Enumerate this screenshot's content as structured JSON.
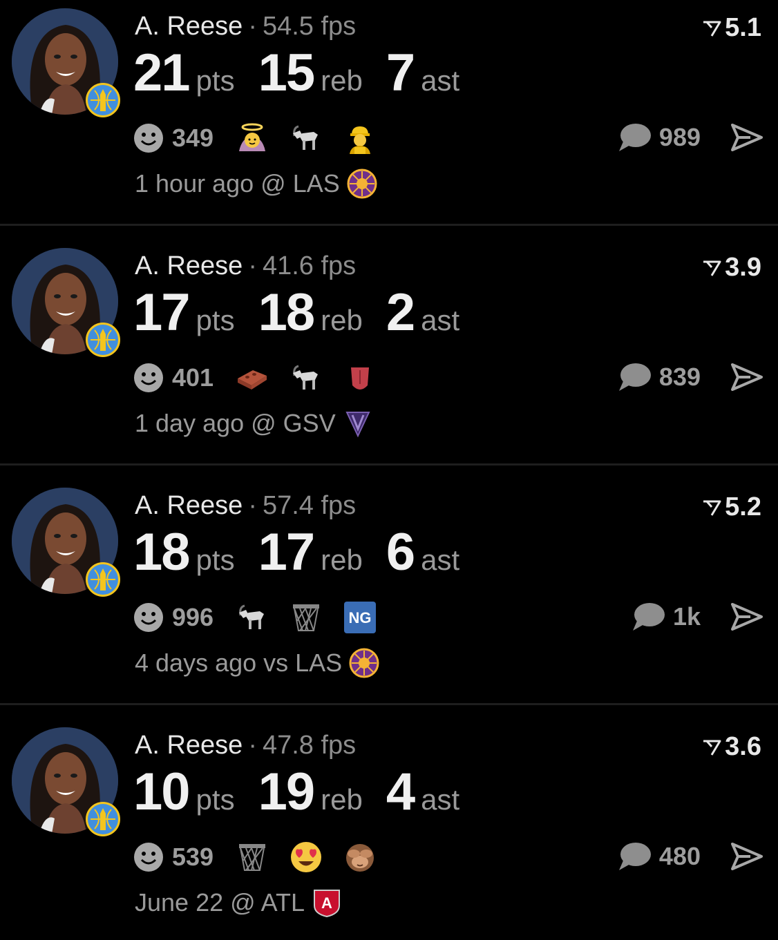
{
  "posts": [
    {
      "player": "A. Reese",
      "fps": "54.5 fps",
      "score": "5.1",
      "stats": [
        {
          "value": "21",
          "unit": "pts"
        },
        {
          "value": "15",
          "unit": "reb"
        },
        {
          "value": "7",
          "unit": "ast"
        }
      ],
      "reaction_count": "349",
      "emojis": [
        "angel-face-emoji",
        "goat-emoji",
        "construction-worker-emoji"
      ],
      "comment_count": "989",
      "time": "1 hour ago @ LAS",
      "opponent_logo": "las-logo"
    },
    {
      "player": "A. Reese",
      "fps": "41.6 fps",
      "score": "3.9",
      "stats": [
        {
          "value": "17",
          "unit": "pts"
        },
        {
          "value": "18",
          "unit": "reb"
        },
        {
          "value": "2",
          "unit": "ast"
        }
      ],
      "reaction_count": "401",
      "emojis": [
        "brick-emoji",
        "goat-emoji",
        "tongue-emoji"
      ],
      "comment_count": "839",
      "time": "1 day ago @ GSV",
      "opponent_logo": "gsv-logo"
    },
    {
      "player": "A. Reese",
      "fps": "57.4 fps",
      "score": "5.2",
      "stats": [
        {
          "value": "18",
          "unit": "pts"
        },
        {
          "value": "17",
          "unit": "reb"
        },
        {
          "value": "6",
          "unit": "ast"
        }
      ],
      "reaction_count": "996",
      "emojis": [
        "goat-emoji",
        "basketball-net-emoji",
        "ng-badge-emoji"
      ],
      "comment_count": "1k",
      "time": "4 days ago vs LAS",
      "opponent_logo": "las-logo"
    },
    {
      "player": "A. Reese",
      "fps": "47.8 fps",
      "score": "3.6",
      "stats": [
        {
          "value": "10",
          "unit": "pts"
        },
        {
          "value": "19",
          "unit": "reb"
        },
        {
          "value": "4",
          "unit": "ast"
        }
      ],
      "reaction_count": "539",
      "emojis": [
        "basketball-net-emoji",
        "heart-eyes-emoji",
        "see-no-evil-monkey-emoji"
      ],
      "comment_count": "480",
      "time": "June 22 @ ATL",
      "opponent_logo": "atl-logo"
    }
  ],
  "ng_badge_text": "NG",
  "atl_logo_text": "A",
  "colors": {
    "background": "#000000",
    "text_primary": "#e8e8e8",
    "text_secondary": "#9a9a9a",
    "divider": "#1e1e1e",
    "team_blue": "#418fde",
    "team_yellow": "#f4c51d"
  }
}
